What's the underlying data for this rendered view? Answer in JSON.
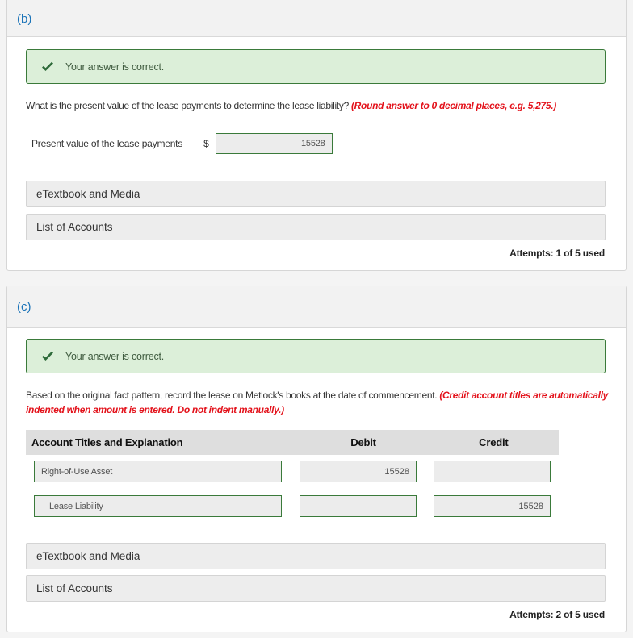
{
  "part_b": {
    "label": "(b)",
    "feedback": "Your answer is correct.",
    "question": "What is the present value of the lease payments to determine the lease liability?",
    "hint": "(Round answer to 0 decimal places, e.g. 5,275.)",
    "field_label": "Present value of the lease payments",
    "currency": "$",
    "field_value": "15528",
    "resources": [
      "eTextbook and Media",
      "List of Accounts"
    ],
    "attempts": "Attempts: 1 of 5 used"
  },
  "part_c": {
    "label": "(c)",
    "feedback": "Your answer is correct.",
    "question": "Based on the original fact pattern, record the lease on Metlock's books at the date of commencement.",
    "hint": "(Credit account titles are automatically indented when amount is entered. Do not indent manually.)",
    "journal": {
      "headers": {
        "account": "Account Titles and Explanation",
        "debit": "Debit",
        "credit": "Credit"
      },
      "rows": [
        {
          "account": "Right-of-Use Asset",
          "debit": "15528",
          "credit": ""
        },
        {
          "account": "Lease Liability",
          "debit": "",
          "credit": "15528"
        }
      ]
    },
    "resources": [
      "eTextbook and Media",
      "List of Accounts"
    ],
    "attempts": "Attempts: 2 of 5 used"
  },
  "colors": {
    "part_label": "#1a73b8",
    "feedback_bg": "#dcefd9",
    "feedback_border": "#3a7a3a",
    "check": "#2e6b3a",
    "hint": "#e3121b"
  }
}
